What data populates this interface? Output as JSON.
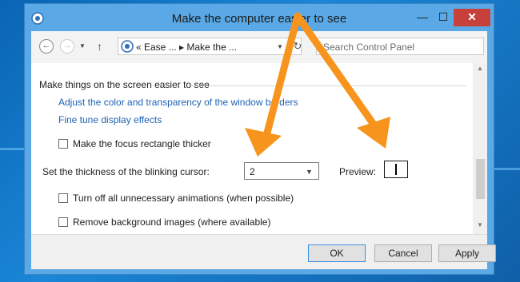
{
  "window": {
    "title": "Make the computer easier to see",
    "minimize_glyph": "—",
    "maximize_glyph": "☐",
    "close_glyph": "✕"
  },
  "nav": {
    "back_glyph": "←",
    "forward_glyph": "→",
    "dropdown_glyph": "▼",
    "up_glyph": "↑"
  },
  "address": {
    "text": "«  Ease ...  ▸  Make the ...",
    "dropdown_glyph": "▼",
    "refresh_glyph": "↻"
  },
  "search": {
    "placeholder": "Search Control Panel"
  },
  "content": {
    "section_heading": "Make things on the screen easier to see",
    "links": [
      "Adjust the color and transparency of the window borders",
      "Fine tune display effects"
    ],
    "focus_rectangle_label": "Make the focus rectangle thicker",
    "cursor_thickness_label": "Set the thickness of the blinking cursor:",
    "cursor_thickness_value": "2",
    "preview_label": "Preview:",
    "animations_label": "Turn off all unnecessary animations (when possible)",
    "background_images_label": "Remove background images (where available)"
  },
  "buttons": {
    "ok": "OK",
    "cancel": "Cancel",
    "apply": "Apply"
  },
  "colors": {
    "arrow": "#f7941d",
    "link": "#1e63b6",
    "close": "#c7403a"
  },
  "icons": {
    "app": "control-panel-icon",
    "arrows": "annotation-arrow"
  }
}
